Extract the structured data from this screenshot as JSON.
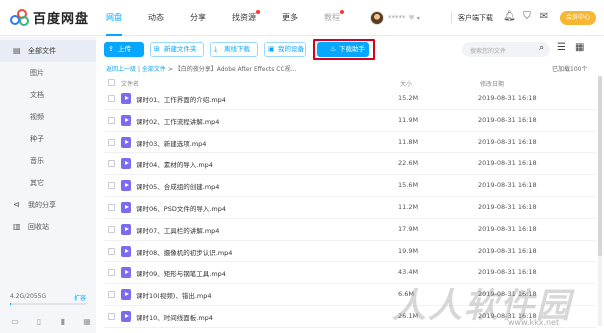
{
  "app": {
    "logo_text": "百度网盘"
  },
  "nav": {
    "items": [
      {
        "label": "网盘"
      },
      {
        "label": "动态"
      },
      {
        "label": "分享"
      },
      {
        "label": "找资源"
      },
      {
        "label": "更多"
      },
      {
        "label": "教程"
      }
    ]
  },
  "header": {
    "username": "*****",
    "client_download": "客户端下载",
    "vip_label": "会员中心"
  },
  "sidebar": {
    "all_files": "全部文件",
    "categories": [
      "图片",
      "文档",
      "视频",
      "种子",
      "音乐",
      "其它"
    ],
    "my_share": "我的分享",
    "recycle": "回收站",
    "quota": "4.2G/2055G",
    "expand": "扩容",
    "quota_fraction": 0.002
  },
  "toolbar": {
    "upload": "上传",
    "new_folder": "新建文件夹",
    "offline_download": "离线下载",
    "my_device": "我的设备",
    "download_helper": "下载助手",
    "search_placeholder": "搜索您的文件"
  },
  "breadcrumb": {
    "back": "返回上一级",
    "all_files": "全部文件",
    "current": "【白的夜分享】Adobe After Effects CC视..."
  },
  "loaded_text": "已加载100个",
  "table": {
    "headers": {
      "name": "文件名",
      "size": "大小",
      "date": "修改日期"
    },
    "rows": [
      {
        "name": "课时01、工作界面的介绍.mp4",
        "size": "15.2M",
        "date": "2019-08-31 16:18"
      },
      {
        "name": "课时02、工作流程讲解.mp4",
        "size": "11.9M",
        "date": "2019-08-31 16:18"
      },
      {
        "name": "课时03、新建选项.mp4",
        "size": "11.8M",
        "date": "2019-08-31 16:18"
      },
      {
        "name": "课时04、素材的导入.mp4",
        "size": "22.6M",
        "date": "2019-08-31 16:18"
      },
      {
        "name": "课时05、合成组的创建.mp4",
        "size": "15.6M",
        "date": "2019-08-31 16:18"
      },
      {
        "name": "课时06、PSD文件的导入.mp4",
        "size": "11.2M",
        "date": "2019-08-31 16:18"
      },
      {
        "name": "课时07、工具栏的讲解.mp4",
        "size": "17.9M",
        "date": "2019-08-31 16:18"
      },
      {
        "name": "课时08、摄像机的初步认识.mp4",
        "size": "19.9M",
        "date": "2019-08-31 16:18"
      },
      {
        "name": "课时09、矩形与钢笔工具.mp4",
        "size": "43.4M",
        "date": "2019-08-31 16:18"
      },
      {
        "name": "课时10(视频)、错出.mp4",
        "size": "6.6M",
        "date": "2019-08-31 16:18"
      },
      {
        "name": "课时10、时间线面板.mp4",
        "size": "26.1M",
        "date": "2019-08-31 16:18"
      }
    ]
  },
  "watermark": {
    "text": "人人软件园",
    "url": "www.kkx.net"
  },
  "colors": {
    "accent": "#06a7ff",
    "highlight_frame": "#d9001b",
    "vip": "#f7b733",
    "video_icon": "#7a6bf0"
  }
}
